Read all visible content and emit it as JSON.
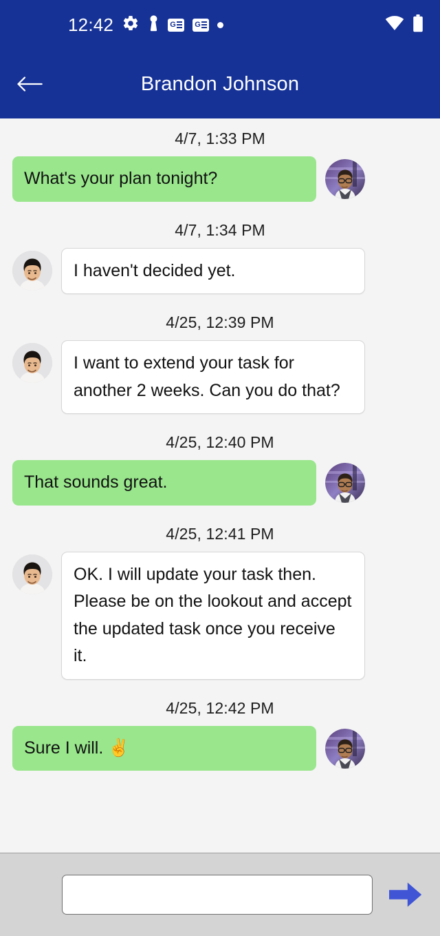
{
  "statusbar": {
    "time": "12:42",
    "icons_left": [
      {
        "name": "gear-icon",
        "label": "settings"
      },
      {
        "name": "keyhole-icon",
        "label": "vpn"
      },
      {
        "name": "google-news-icon",
        "label": "GE"
      },
      {
        "name": "google-news-icon-2",
        "label": "GE"
      },
      {
        "name": "dot-icon",
        "label": "notification"
      }
    ],
    "icons_right": [
      {
        "name": "wifi-icon",
        "label": "wifi"
      },
      {
        "name": "battery-icon",
        "label": "battery"
      }
    ]
  },
  "appbar": {
    "back_label": "Back",
    "title": "Brandon Johnson"
  },
  "colors": {
    "header_blue": "#163296",
    "sent_bubble_green": "#99e68c",
    "received_bubble_white": "#ffffff",
    "chat_background": "#f4f4f4",
    "composer_background": "#d4d4d4",
    "send_arrow_blue": "#3f55d6"
  },
  "messages": [
    {
      "timestamp": "4/7, 1:33 PM",
      "text": "What's your plan tonight?",
      "direction": "sent"
    },
    {
      "timestamp": "4/7, 1:34 PM",
      "text": "I haven't decided yet.",
      "direction": "received"
    },
    {
      "timestamp": "4/25, 12:39 PM",
      "text": "I want to extend your task for another 2 weeks. Can you do that?",
      "direction": "received"
    },
    {
      "timestamp": "4/25, 12:40 PM",
      "text": "That sounds great.",
      "direction": "sent"
    },
    {
      "timestamp": "4/25, 12:41 PM",
      "text": "OK. I will update your task then. Please be on the lookout and accept the updated task once you receive it.",
      "direction": "received"
    },
    {
      "timestamp": "4/25, 12:42 PM",
      "text": "Sure I will. ✌",
      "direction": "sent"
    }
  ],
  "composer": {
    "input_value": "",
    "input_placeholder": "",
    "send_label": "Send"
  }
}
